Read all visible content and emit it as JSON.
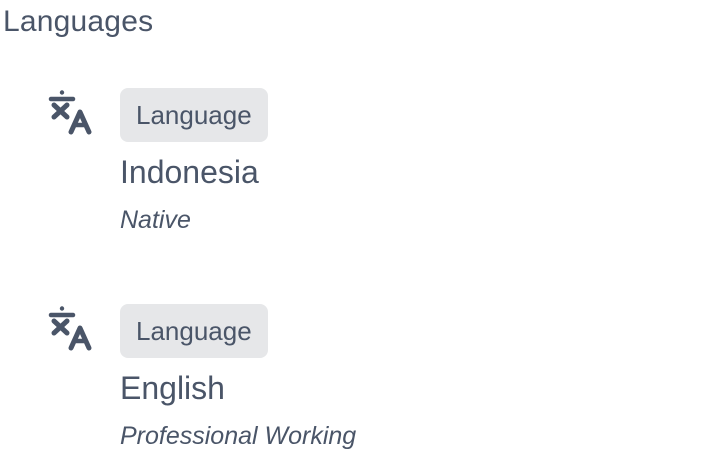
{
  "section": {
    "title": "Languages"
  },
  "languages": [
    {
      "icon": "translate-icon",
      "badge": "Language",
      "name": "Indonesia",
      "level": "Native"
    },
    {
      "icon": "translate-icon",
      "badge": "Language",
      "name": "English",
      "level": "Professional Working"
    }
  ],
  "colors": {
    "text": "#4a5568",
    "badge_background": "#e6e7e9",
    "icon": "#4a5568"
  }
}
